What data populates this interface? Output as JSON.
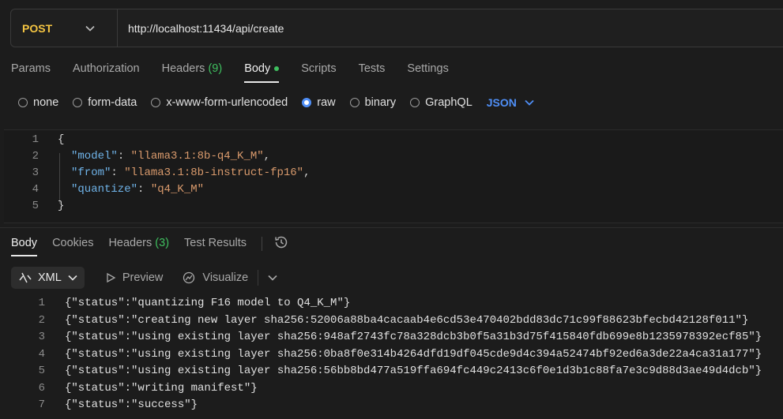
{
  "request": {
    "method": "POST",
    "url": "http://localhost:11434/api/create"
  },
  "request_tabs": {
    "params": "Params",
    "authorization": "Authorization",
    "headers": "Headers",
    "headers_count": "(9)",
    "body": "Body",
    "scripts": "Scripts",
    "tests": "Tests",
    "settings": "Settings"
  },
  "body_types": {
    "none": "none",
    "form_data": "form-data",
    "urlencoded": "x-www-form-urlencoded",
    "raw": "raw",
    "binary": "binary",
    "graphql": "GraphQL",
    "selected": "raw",
    "language": "JSON"
  },
  "request_body": {
    "line_numbers": [
      "1",
      "2",
      "3",
      "4",
      "5"
    ],
    "open_brace": "{",
    "close_brace": "}",
    "fields": [
      {
        "key": "\"model\"",
        "value": "\"llama3.1:8b-q4_K_M\"",
        "trail": ","
      },
      {
        "key": "\"from\"",
        "value": "\"llama3.1:8b-instruct-fp16\"",
        "trail": ","
      },
      {
        "key": "\"quantize\"",
        "value": "\"q4_K_M\"",
        "trail": ""
      }
    ]
  },
  "response_tabs": {
    "body": "Body",
    "cookies": "Cookies",
    "headers": "Headers",
    "headers_count": "(3)",
    "test_results": "Test Results"
  },
  "response_toolbar": {
    "format": "XML",
    "preview": "Preview",
    "visualize": "Visualize"
  },
  "response_lines": [
    {
      "n": "1",
      "text": "{\"status\":\"quantizing F16 model to Q4_K_M\"}"
    },
    {
      "n": "2",
      "text": "{\"status\":\"creating new layer sha256:52006a88ba4cacaab4e6cd53e470402bdd83dc71c99f88623bfecbd42128f011\"}"
    },
    {
      "n": "3",
      "text": "{\"status\":\"using existing layer sha256:948af2743fc78a328dcb3b0f5a31b3d75f415840fdb699e8b1235978392ecf85\"}"
    },
    {
      "n": "4",
      "text": "{\"status\":\"using existing layer sha256:0ba8f0e314b4264dfd19df045cde9d4c394a52474bf92ed6a3de22a4ca31a177\"}"
    },
    {
      "n": "5",
      "text": "{\"status\":\"using existing layer sha256:56bb8bd477a519ffa694fc449c2413c6f0e1d3b1c88fa7e3c9d88d3ae49d4dcb\"}"
    },
    {
      "n": "6",
      "text": "{\"status\":\"writing manifest\"}"
    },
    {
      "n": "7",
      "text": "{\"status\":\"success\"}"
    }
  ],
  "colors": {
    "method": "#f5c542",
    "accent": "#4f8ff7",
    "indicator": "#3fbf5f",
    "json_key": "#6fb3e8",
    "json_string": "#d99a6c"
  }
}
